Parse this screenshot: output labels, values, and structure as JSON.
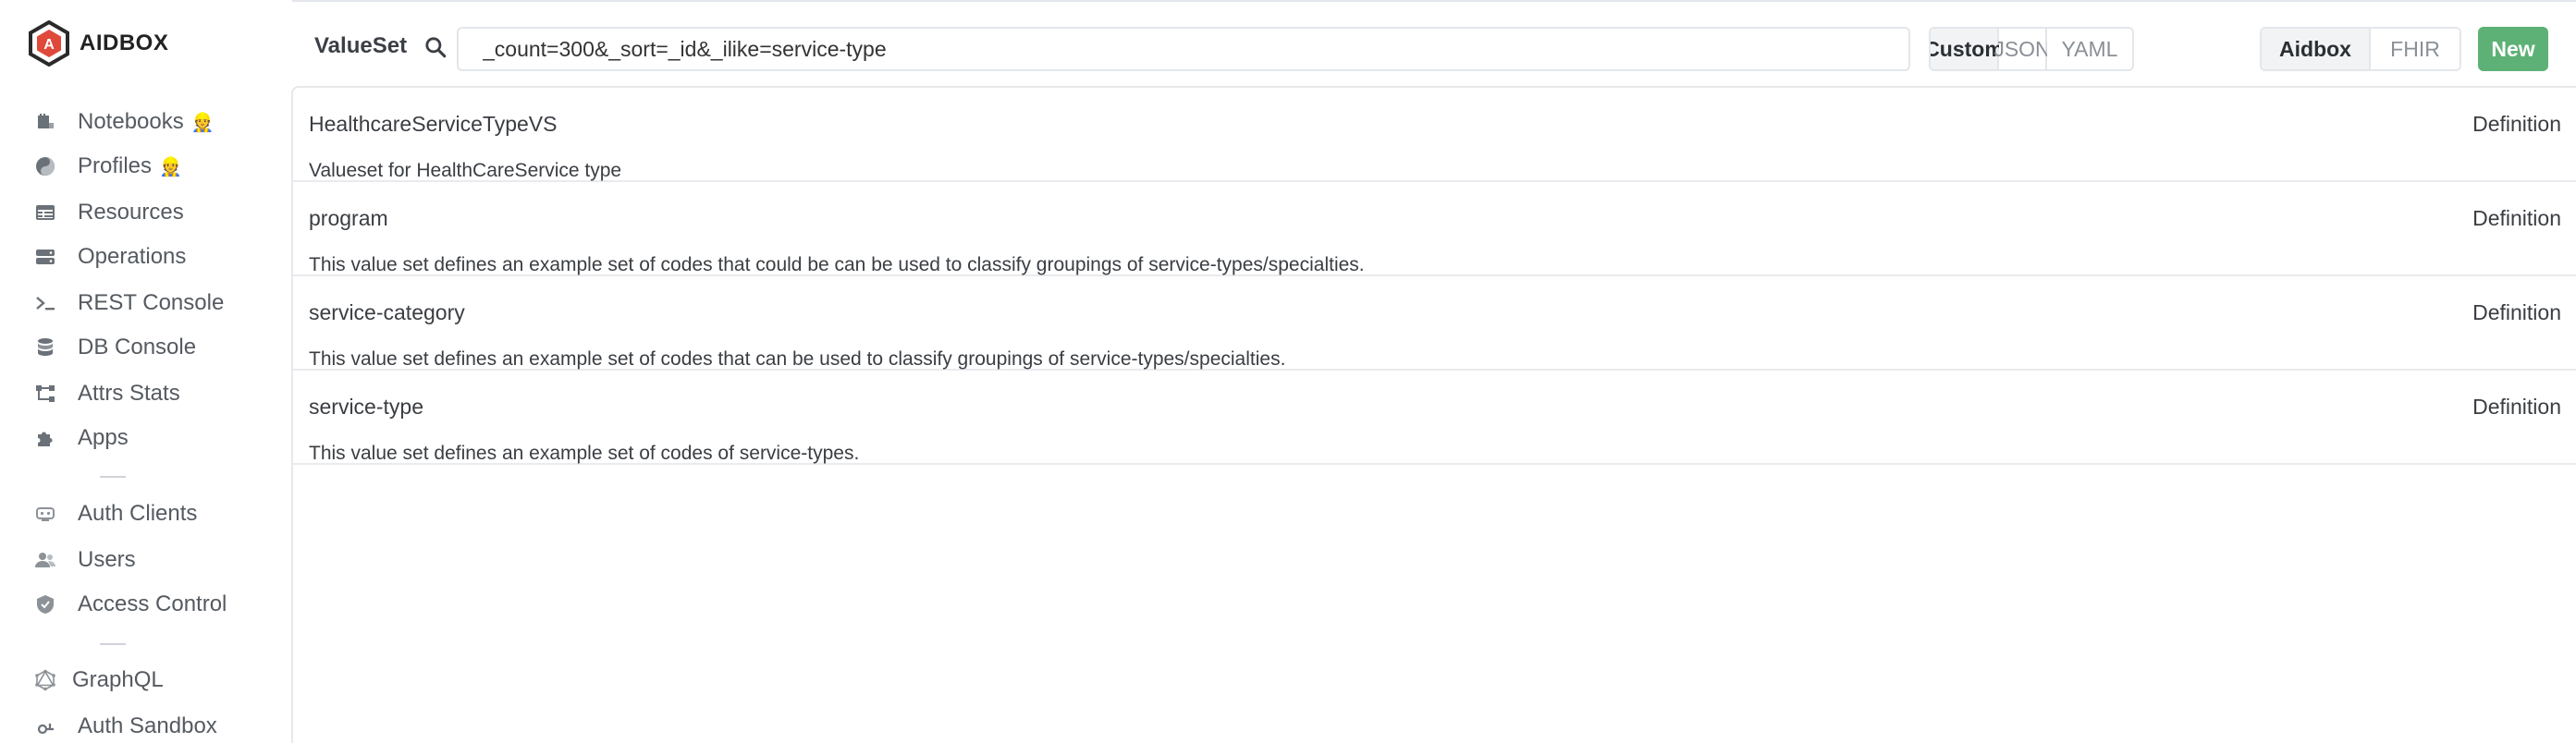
{
  "brand": {
    "name": "AIDBOX"
  },
  "sidebar": {
    "items": [
      {
        "label": "Notebooks",
        "icon": "notebook-icon",
        "badge": "👷"
      },
      {
        "label": "Profiles",
        "icon": "profiles-icon",
        "badge": "👷"
      },
      {
        "label": "Resources",
        "icon": "resources-icon"
      },
      {
        "label": "Operations",
        "icon": "operations-icon"
      },
      {
        "label": "REST Console",
        "icon": "terminal-icon"
      },
      {
        "label": "DB Console",
        "icon": "database-icon"
      },
      {
        "label": "Attrs Stats",
        "icon": "attrs-stats-icon"
      },
      {
        "label": "Apps",
        "icon": "puzzle-icon"
      },
      {
        "label": "Auth Clients",
        "icon": "auth-clients-icon"
      },
      {
        "label": "Users",
        "icon": "users-icon"
      },
      {
        "label": "Access Control",
        "icon": "shield-icon"
      },
      {
        "label": "GraphQL",
        "icon": "graphql-icon"
      },
      {
        "label": "Auth Sandbox",
        "icon": "auth-sandbox-icon"
      }
    ]
  },
  "header": {
    "resource_type": "ValueSet",
    "query": "_count=300&_sort=_id&_ilike=service-type",
    "format_tabs": [
      "Custom",
      "JSON",
      "YAML"
    ],
    "format_active": "Custom",
    "mode_tabs": [
      "Aidbox",
      "FHIR"
    ],
    "mode_active": "Aidbox",
    "new_label": "New"
  },
  "results": [
    {
      "name": "HealthcareServiceTypeVS",
      "type": "Definition",
      "description": "Valueset for HealthCareService type"
    },
    {
      "name": "program",
      "type": "Definition",
      "description": "This value set defines an example set of codes that could be can be used to classify groupings of service-types/specialties."
    },
    {
      "name": "service-category",
      "type": "Definition",
      "description": "This value set defines an example set of codes that can be used to classify groupings of service-types/specialties."
    },
    {
      "name": "service-type",
      "type": "Definition",
      "description": "This value set defines an example set of codes of service-types."
    }
  ],
  "colors": {
    "accent_green": "#5db176",
    "badge_orange": "#e0763b",
    "logo_red": "#e0483a"
  }
}
